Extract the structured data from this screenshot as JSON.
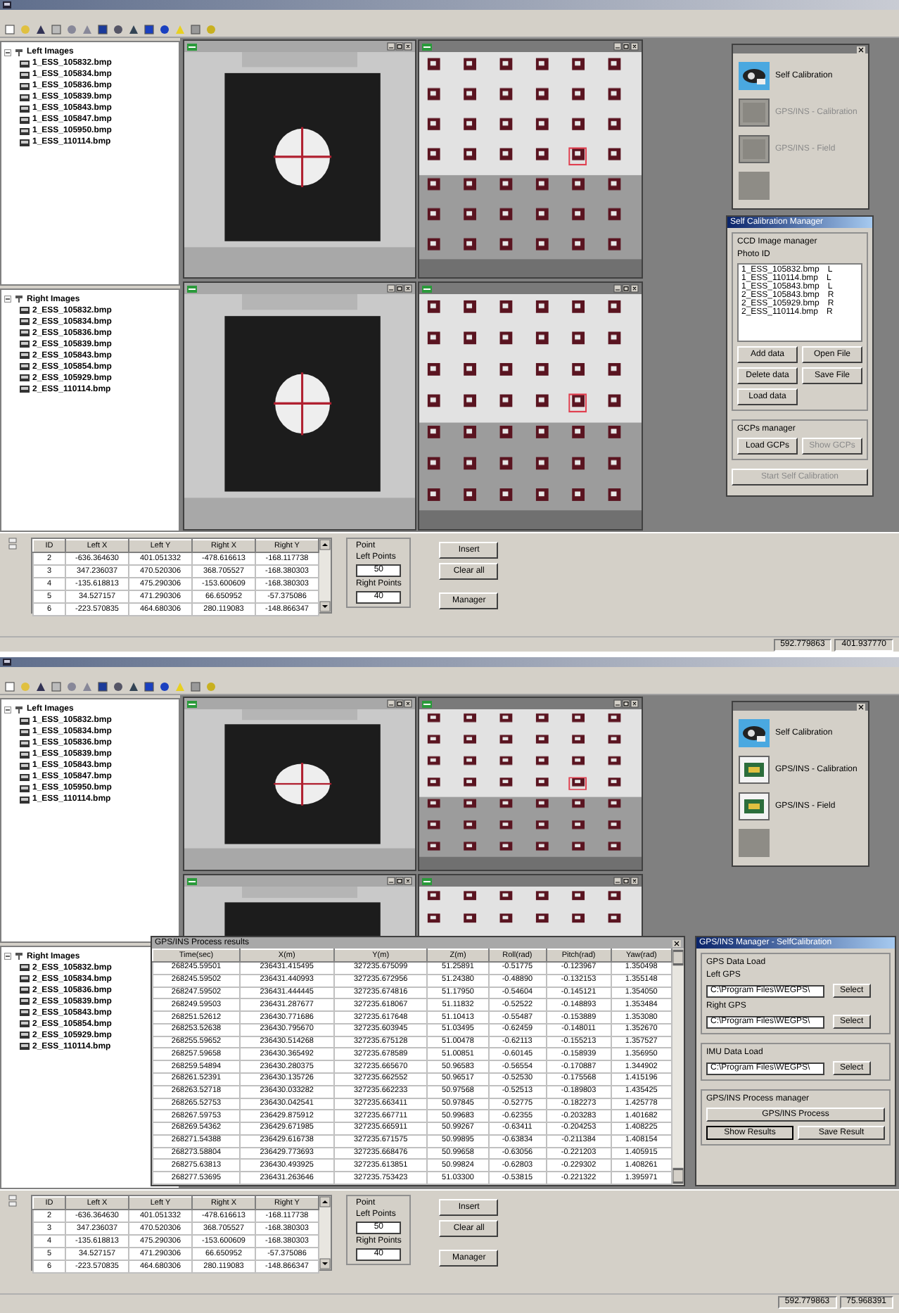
{
  "screens": [
    {
      "left_tree": {
        "label": "Left Images",
        "expanded": true,
        "children": [
          {
            "label": "1_ESS_105832.bmp"
          },
          {
            "label": "1_ESS_105834.bmp"
          },
          {
            "label": "1_ESS_105836.bmp"
          },
          {
            "label": "1_ESS_105839.bmp"
          },
          {
            "label": "1_ESS_105843.bmp"
          },
          {
            "label": "1_ESS_105847.bmp"
          },
          {
            "label": "1_ESS_105950.bmp"
          },
          {
            "label": "1_ESS_110114.bmp"
          }
        ]
      },
      "right_tree": {
        "label": "Right Images",
        "expanded": true,
        "children": [
          {
            "label": "2_ESS_105832.bmp"
          },
          {
            "label": "2_ESS_105834.bmp"
          },
          {
            "label": "2_ESS_105836.bmp"
          },
          {
            "label": "2_ESS_105839.bmp"
          },
          {
            "label": "2_ESS_105843.bmp"
          },
          {
            "label": "2_ESS_105854.bmp"
          },
          {
            "label": "2_ESS_105929.bmp"
          },
          {
            "label": "2_ESS_110114.bmp"
          }
        ]
      },
      "image_windows": [
        {
          "kind": "target"
        },
        {
          "kind": "grid"
        },
        {
          "kind": "target"
        },
        {
          "kind": "grid"
        }
      ],
      "mode_panel": {
        "buttons": [
          {
            "label": "Self Calibration",
            "kind": "camera",
            "disabled": false
          },
          {
            "label": "GPS/INS - Calibration",
            "kind": "gps",
            "disabled": true
          },
          {
            "label": "GPS/INS - Field",
            "kind": "gps",
            "disabled": true
          },
          {
            "kind": "blank",
            "disabled": true
          }
        ]
      },
      "calibration_manager": {
        "title": "Self Calibration Manager",
        "image_group": "CCD Image manager",
        "list_header": "Photo ID",
        "photos": [
          {
            "name": "1_ESS_105832.bmp",
            "side": "L"
          },
          {
            "name": "1_ESS_110114.bmp",
            "side": "L"
          },
          {
            "name": "1_ESS_105843.bmp",
            "side": "L"
          },
          {
            "name": "2_ESS_105843.bmp",
            "side": "R"
          },
          {
            "name": "2_ESS_105929.bmp",
            "side": "R"
          },
          {
            "name": "2_ESS_110114.bmp",
            "side": "R"
          }
        ],
        "buttons": [
          {
            "label": "Add data",
            "disabled": false
          },
          {
            "label": "Open File",
            "disabled": false
          },
          {
            "label": "Delete data",
            "disabled": false
          },
          {
            "label": "Save File",
            "disabled": false
          },
          {
            "label": "Load data",
            "disabled": false
          }
        ],
        "gcp_group": "GCPs manager",
        "gcp_buttons": [
          {
            "label": "Load GCPs",
            "disabled": false
          },
          {
            "label": "Show GCPs",
            "disabled": true
          }
        ],
        "start_button": {
          "label": "Start Self Calibration",
          "disabled": true
        }
      },
      "points_table": {
        "columns": [
          "ID",
          "Left X",
          "Left Y",
          "Right X",
          "Right Y"
        ],
        "rows": [
          [
            "2",
            "-636.364630",
            "401.051332",
            "-478.616613",
            "-168.117738"
          ],
          [
            "3",
            "347.236037",
            "470.520306",
            "368.705527",
            "-168.380303"
          ],
          [
            "4",
            "-135.618813",
            "475.290306",
            "-153.600609",
            "-168.380303"
          ],
          [
            "5",
            "34.527157",
            "471.290306",
            "66.650952",
            "-57.375086"
          ],
          [
            "6",
            "-223.570835",
            "464.680306",
            "280.119083",
            "-148.866347"
          ]
        ]
      },
      "point_group": {
        "title": "Point",
        "left_label": "Left Points",
        "left_value": "50",
        "right_label": "Right Points",
        "right_value": "40"
      },
      "buttons": [
        "Insert",
        "Clear all",
        "Manager"
      ],
      "status": [
        "592.779863",
        "401.937770"
      ]
    },
    {
      "left_tree": {
        "label": "Left Images",
        "expanded": true,
        "children": [
          {
            "label": "1_ESS_105832.bmp"
          },
          {
            "label": "1_ESS_105834.bmp"
          },
          {
            "label": "1_ESS_105836.bmp"
          },
          {
            "label": "1_ESS_105839.bmp"
          },
          {
            "label": "1_ESS_105843.bmp"
          },
          {
            "label": "1_ESS_105847.bmp"
          },
          {
            "label": "1_ESS_105950.bmp"
          },
          {
            "label": "1_ESS_110114.bmp"
          }
        ]
      },
      "right_tree": {
        "label": "Right Images",
        "expanded": true,
        "children": [
          {
            "label": "2_ESS_105832.bmp"
          },
          {
            "label": "2_ESS_105834.bmp"
          },
          {
            "label": "2_ESS_105836.bmp"
          },
          {
            "label": "2_ESS_105839.bmp"
          },
          {
            "label": "2_ESS_105843.bmp"
          },
          {
            "label": "2_ESS_105854.bmp"
          },
          {
            "label": "2_ESS_105929.bmp"
          },
          {
            "label": "2_ESS_110114.bmp"
          }
        ]
      },
      "image_windows": [
        {
          "kind": "target"
        },
        {
          "kind": "grid"
        },
        {
          "kind": "target"
        },
        {
          "kind": "grid"
        }
      ],
      "mode_panel": {
        "buttons": [
          {
            "label": "Self Calibration",
            "kind": "camera",
            "disabled": false
          },
          {
            "label": "GPS/INS - Calibration",
            "kind": "gps",
            "disabled": false
          },
          {
            "label": "GPS/INS - Field",
            "kind": "gps",
            "disabled": false
          },
          {
            "kind": "blank",
            "disabled": true
          }
        ]
      },
      "results_window": {
        "title": "GPS/INS Process results",
        "columns": [
          "Time(sec)",
          "X(m)",
          "Y(m)",
          "Z(m)",
          "Roll(rad)",
          "Pitch(rad)",
          "Yaw(rad)"
        ],
        "rows": [
          [
            "268245.59501",
            "236431.415495",
            "327235.675099",
            "51.25891",
            "-0.51775",
            "-0.123967",
            "1.350498"
          ],
          [
            "268245.59502",
            "236431.440993",
            "327235.672956",
            "51.24380",
            "-0.48890",
            "-0.132153",
            "1.355148"
          ],
          [
            "268247.59502",
            "236431.444445",
            "327235.674816",
            "51.17950",
            "-0.54604",
            "-0.145121",
            "1.354050"
          ],
          [
            "268249.59503",
            "236431.287677",
            "327235.618067",
            "51.11832",
            "-0.52522",
            "-0.148893",
            "1.353484"
          ],
          [
            "268251.52612",
            "236430.771686",
            "327235.617648",
            "51.10413",
            "-0.55487",
            "-0.153889",
            "1.353080"
          ],
          [
            "268253.52638",
            "236430.795670",
            "327235.603945",
            "51.03495",
            "-0.62459",
            "-0.148011",
            "1.352670"
          ],
          [
            "268255.59652",
            "236430.514268",
            "327235.675128",
            "51.00478",
            "-0.62113",
            "-0.155213",
            "1.357527"
          ],
          [
            "268257.59658",
            "236430.365492",
            "327235.678589",
            "51.00851",
            "-0.60145",
            "-0.158939",
            "1.356950"
          ],
          [
            "268259.54894",
            "236430.280375",
            "327235.665670",
            "50.96583",
            "-0.56554",
            "-0.170887",
            "1.344902"
          ],
          [
            "268261.52391",
            "236430.135726",
            "327235.662552",
            "50.96517",
            "-0.52530",
            "-0.175568",
            "1.415196"
          ],
          [
            "268263.52718",
            "236430.033282",
            "327235.662233",
            "50.97568",
            "-0.52513",
            "-0.189803",
            "1.435425"
          ],
          [
            "268265.52753",
            "236430.042541",
            "327235.663411",
            "50.97845",
            "-0.52775",
            "-0.182273",
            "1.425778"
          ],
          [
            "268267.59753",
            "236429.875912",
            "327235.667711",
            "50.99683",
            "-0.62355",
            "-0.203283",
            "1.401682"
          ],
          [
            "268269.54362",
            "236429.671985",
            "327235.665911",
            "50.99267",
            "-0.63411",
            "-0.204253",
            "1.408225"
          ],
          [
            "268271.54388",
            "236429.616738",
            "327235.671575",
            "50.99895",
            "-0.63834",
            "-0.211384",
            "1.408154"
          ],
          [
            "268273.58804",
            "236429.773693",
            "327235.668476",
            "50.99658",
            "-0.63056",
            "-0.221203",
            "1.405915"
          ],
          [
            "268275.63813",
            "236430.493925",
            "327235.613851",
            "50.99824",
            "-0.62803",
            "-0.229302",
            "1.408261"
          ],
          [
            "268277.53695",
            "236431.263646",
            "327235.753423",
            "51.03300",
            "-0.53815",
            "-0.221322",
            "1.395971"
          ]
        ]
      },
      "gps_manager": {
        "title": "GPS/INS Manager - SelfCalibration",
        "gps_group": "GPS Data Load",
        "left_label": "Left GPS",
        "left_path": "C:\\Program Files\\WEGPS\\",
        "right_label": "Right GPS",
        "right_path": "C:\\Program Files\\WEGPS\\",
        "imu_group": "IMU Data Load",
        "imu_path": "C:\\Program Files\\WEGPS\\",
        "select": [
          "Select",
          "Select",
          "Select"
        ],
        "process_group": "GPS/INS Process manager",
        "process_button": "GPS/INS Process",
        "show_button": "Show Results",
        "save_button": "Save Result"
      },
      "points_table": {
        "columns": [
          "ID",
          "Left X",
          "Left Y",
          "Right X",
          "Right Y"
        ],
        "rows": [
          [
            "2",
            "-636.364630",
            "401.051332",
            "-478.616613",
            "-168.117738"
          ],
          [
            "3",
            "347.236037",
            "470.520306",
            "368.705527",
            "-168.380303"
          ],
          [
            "4",
            "-135.618813",
            "475.290306",
            "-153.600609",
            "-168.380303"
          ],
          [
            "5",
            "34.527157",
            "471.290306",
            "66.650952",
            "-57.375086"
          ],
          [
            "6",
            "-223.570835",
            "464.680306",
            "280.119083",
            "-148.866347"
          ]
        ]
      },
      "point_group": {
        "title": "Point",
        "left_label": "Left Points",
        "left_value": "50",
        "right_label": "Right Points",
        "right_value": "40"
      },
      "buttons": [
        "Insert",
        "Clear all",
        "Manager"
      ],
      "status": [
        "592.779863",
        "75.968391"
      ]
    }
  ]
}
